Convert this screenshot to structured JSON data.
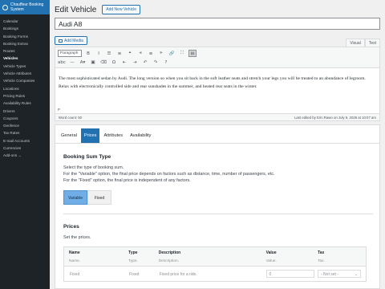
{
  "sidebar": {
    "plugin_title": "Chauffeur Booking System",
    "items": [
      {
        "label": "Calendar",
        "active": false
      },
      {
        "label": "Bookings",
        "active": false
      },
      {
        "label": "Booking Forms",
        "active": false
      },
      {
        "label": "Booking Extras",
        "active": false
      },
      {
        "label": "Routes",
        "active": false
      },
      {
        "label": "Vehicles",
        "active": true
      },
      {
        "label": "Vehicle Types",
        "active": false
      },
      {
        "label": "Vehicle Attributes",
        "active": false
      },
      {
        "label": "Vehicle Companies",
        "active": false
      },
      {
        "label": "Locations",
        "active": false
      },
      {
        "label": "Pricing Rules",
        "active": false
      },
      {
        "label": "Availability Rules",
        "active": false
      },
      {
        "label": "Drivers",
        "active": false
      },
      {
        "label": "Coupons",
        "active": false
      },
      {
        "label": "Geofence",
        "active": false
      },
      {
        "label": "Tax Rates",
        "active": false
      },
      {
        "label": "E-mail Accounts",
        "active": false
      },
      {
        "label": "Currencies",
        "active": false
      },
      {
        "label": "Add-ons →",
        "active": false
      }
    ]
  },
  "header": {
    "title": "Edit Vehicle",
    "add_new_label": "Add New Vehicle"
  },
  "post_title": {
    "value": "Audi A8"
  },
  "media": {
    "add_media_label": "Add Media"
  },
  "editor_tabs": {
    "visual": "Visual",
    "text": "Text"
  },
  "toolbar": {
    "format_select": "Paragraph",
    "row1_icons": [
      "bold-icon",
      "italic-icon",
      "bulleted-list-icon",
      "numbered-list-icon",
      "blockquote-icon",
      "align-left-icon",
      "align-center-icon",
      "align-right-icon",
      "link-icon",
      "fullscreen-icon",
      "toolbar-toggle-icon"
    ],
    "row1_glyphs": [
      "B",
      "I",
      "☰",
      "≡",
      "❝",
      "⫷",
      "≡",
      "⫸",
      "🔗",
      "⛶",
      "▤"
    ],
    "row2_icons": [
      "strikethrough-icon",
      "horizontal-line-icon",
      "text-color-icon",
      "paste-text-icon",
      "clear-formatting-icon",
      "special-character-icon",
      "outdent-icon",
      "indent-icon",
      "undo-icon",
      "redo-icon",
      "help-icon"
    ],
    "row2_glyphs": [
      "abc",
      "—",
      "A▾",
      "▣",
      "⌫",
      "Ω",
      "⇤",
      "⇥",
      "↶",
      "↷",
      "?"
    ]
  },
  "editor": {
    "content": "The most sophisticated sedan by Audi. The long version so when you sit back in the soft leather seats and stretch your legs you will be treated to an abundance of legroom. Relax with electronically controlled side and rear sunshades in the summer, and heated rear seats in the winter.",
    "path": "P",
    "word_count": "Word count: 50",
    "last_edited": "Last edited by Erin Rawo on July 9, 2025 at 10:07 am"
  },
  "settings": {
    "tabs": [
      {
        "label": "General",
        "active": false
      },
      {
        "label": "Prices",
        "active": true
      },
      {
        "label": "Attributes",
        "active": false
      },
      {
        "label": "Availability",
        "active": false
      }
    ],
    "booking_sum": {
      "title": "Booking Sum Type",
      "desc1": "Select the type of booking sum.",
      "desc2": "For the \"Variable\" option, the final price depends on factors such as distance, time, number of passengers, etc.",
      "desc3": "For the \"Fixed\" option, the final price is independent of any factors.",
      "variable_label": "Variable",
      "fixed_label": "Fixed",
      "selected": "Variable"
    },
    "prices": {
      "title": "Prices",
      "desc": "Set the prices.",
      "columns": [
        {
          "header": "Name",
          "sub": "Name."
        },
        {
          "header": "Type",
          "sub": "Type."
        },
        {
          "header": "Description",
          "sub": "Description."
        },
        {
          "header": "Value",
          "sub": "Value."
        },
        {
          "header": "Tax",
          "sub": "Tax."
        }
      ],
      "row": {
        "name": "Fixed",
        "type": "Fixed",
        "description": "Fixed price for a ride.",
        "value": "0",
        "tax": "- Not set -"
      }
    }
  }
}
